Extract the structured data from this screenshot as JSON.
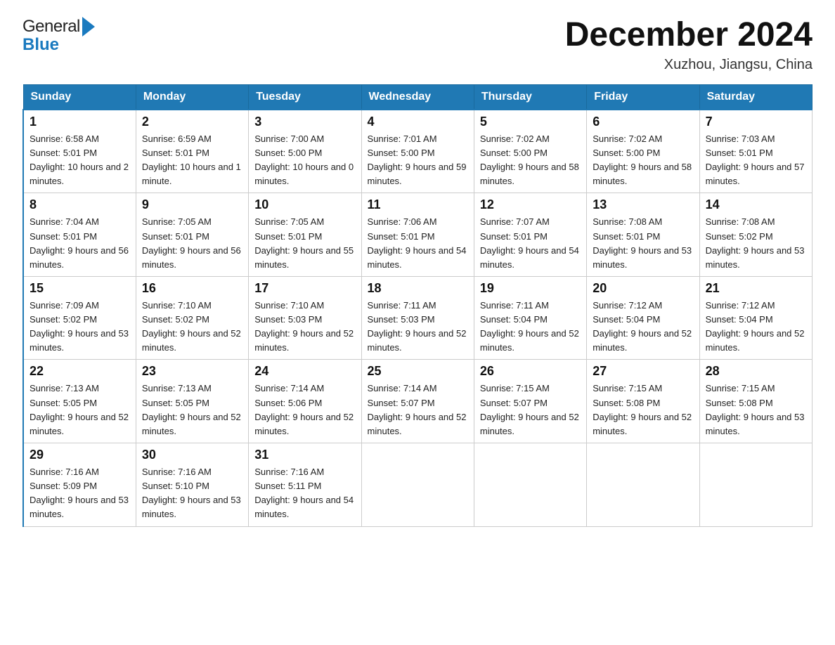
{
  "header": {
    "month_title": "December 2024",
    "location": "Xuzhou, Jiangsu, China",
    "logo_general": "General",
    "logo_blue": "Blue"
  },
  "weekdays": [
    "Sunday",
    "Monday",
    "Tuesday",
    "Wednesday",
    "Thursday",
    "Friday",
    "Saturday"
  ],
  "weeks": [
    [
      {
        "day": "1",
        "sunrise": "6:58 AM",
        "sunset": "5:01 PM",
        "daylight": "10 hours and 2 minutes."
      },
      {
        "day": "2",
        "sunrise": "6:59 AM",
        "sunset": "5:01 PM",
        "daylight": "10 hours and 1 minute."
      },
      {
        "day": "3",
        "sunrise": "7:00 AM",
        "sunset": "5:00 PM",
        "daylight": "10 hours and 0 minutes."
      },
      {
        "day": "4",
        "sunrise": "7:01 AM",
        "sunset": "5:00 PM",
        "daylight": "9 hours and 59 minutes."
      },
      {
        "day": "5",
        "sunrise": "7:02 AM",
        "sunset": "5:00 PM",
        "daylight": "9 hours and 58 minutes."
      },
      {
        "day": "6",
        "sunrise": "7:02 AM",
        "sunset": "5:00 PM",
        "daylight": "9 hours and 58 minutes."
      },
      {
        "day": "7",
        "sunrise": "7:03 AM",
        "sunset": "5:01 PM",
        "daylight": "9 hours and 57 minutes."
      }
    ],
    [
      {
        "day": "8",
        "sunrise": "7:04 AM",
        "sunset": "5:01 PM",
        "daylight": "9 hours and 56 minutes."
      },
      {
        "day": "9",
        "sunrise": "7:05 AM",
        "sunset": "5:01 PM",
        "daylight": "9 hours and 56 minutes."
      },
      {
        "day": "10",
        "sunrise": "7:05 AM",
        "sunset": "5:01 PM",
        "daylight": "9 hours and 55 minutes."
      },
      {
        "day": "11",
        "sunrise": "7:06 AM",
        "sunset": "5:01 PM",
        "daylight": "9 hours and 54 minutes."
      },
      {
        "day": "12",
        "sunrise": "7:07 AM",
        "sunset": "5:01 PM",
        "daylight": "9 hours and 54 minutes."
      },
      {
        "day": "13",
        "sunrise": "7:08 AM",
        "sunset": "5:01 PM",
        "daylight": "9 hours and 53 minutes."
      },
      {
        "day": "14",
        "sunrise": "7:08 AM",
        "sunset": "5:02 PM",
        "daylight": "9 hours and 53 minutes."
      }
    ],
    [
      {
        "day": "15",
        "sunrise": "7:09 AM",
        "sunset": "5:02 PM",
        "daylight": "9 hours and 53 minutes."
      },
      {
        "day": "16",
        "sunrise": "7:10 AM",
        "sunset": "5:02 PM",
        "daylight": "9 hours and 52 minutes."
      },
      {
        "day": "17",
        "sunrise": "7:10 AM",
        "sunset": "5:03 PM",
        "daylight": "9 hours and 52 minutes."
      },
      {
        "day": "18",
        "sunrise": "7:11 AM",
        "sunset": "5:03 PM",
        "daylight": "9 hours and 52 minutes."
      },
      {
        "day": "19",
        "sunrise": "7:11 AM",
        "sunset": "5:04 PM",
        "daylight": "9 hours and 52 minutes."
      },
      {
        "day": "20",
        "sunrise": "7:12 AM",
        "sunset": "5:04 PM",
        "daylight": "9 hours and 52 minutes."
      },
      {
        "day": "21",
        "sunrise": "7:12 AM",
        "sunset": "5:04 PM",
        "daylight": "9 hours and 52 minutes."
      }
    ],
    [
      {
        "day": "22",
        "sunrise": "7:13 AM",
        "sunset": "5:05 PM",
        "daylight": "9 hours and 52 minutes."
      },
      {
        "day": "23",
        "sunrise": "7:13 AM",
        "sunset": "5:05 PM",
        "daylight": "9 hours and 52 minutes."
      },
      {
        "day": "24",
        "sunrise": "7:14 AM",
        "sunset": "5:06 PM",
        "daylight": "9 hours and 52 minutes."
      },
      {
        "day": "25",
        "sunrise": "7:14 AM",
        "sunset": "5:07 PM",
        "daylight": "9 hours and 52 minutes."
      },
      {
        "day": "26",
        "sunrise": "7:15 AM",
        "sunset": "5:07 PM",
        "daylight": "9 hours and 52 minutes."
      },
      {
        "day": "27",
        "sunrise": "7:15 AM",
        "sunset": "5:08 PM",
        "daylight": "9 hours and 52 minutes."
      },
      {
        "day": "28",
        "sunrise": "7:15 AM",
        "sunset": "5:08 PM",
        "daylight": "9 hours and 53 minutes."
      }
    ],
    [
      {
        "day": "29",
        "sunrise": "7:16 AM",
        "sunset": "5:09 PM",
        "daylight": "9 hours and 53 minutes."
      },
      {
        "day": "30",
        "sunrise": "7:16 AM",
        "sunset": "5:10 PM",
        "daylight": "9 hours and 53 minutes."
      },
      {
        "day": "31",
        "sunrise": "7:16 AM",
        "sunset": "5:11 PM",
        "daylight": "9 hours and 54 minutes."
      },
      null,
      null,
      null,
      null
    ]
  ]
}
